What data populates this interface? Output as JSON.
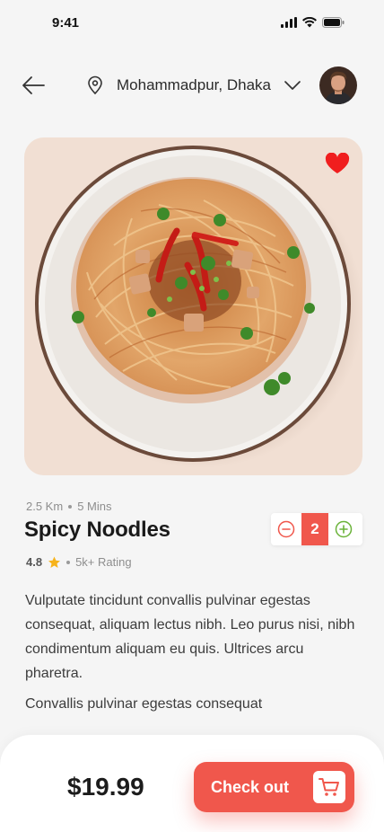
{
  "status": {
    "time": "9:41"
  },
  "header": {
    "location": "Mohammadpur, Dhaka"
  },
  "product": {
    "distance": "2.5 Km",
    "duration": "5 Mins",
    "name": "Spicy Noodles",
    "rating": "4.8",
    "rating_count": "5k+ Rating",
    "quantity": "2",
    "description": "Vulputate tincidunt convallis pulvinar egestas consequat, aliquam lectus nibh. Leo purus nisi, nibh condimentum aliquam eu quis. Ultrices arcu pharetra.",
    "description_2": "Convallis pulvinar egestas consequat",
    "favorite": true
  },
  "footer": {
    "price": "$19.99",
    "checkout_label": "Check out"
  },
  "colors": {
    "accent": "#f0574c",
    "plus": "#6bb33a",
    "star": "#f6b31b",
    "hero_bg": "#f1dfd3"
  },
  "icons": [
    "back-arrow-icon",
    "location-pin-icon",
    "chevron-down-icon",
    "heart-icon",
    "star-icon",
    "minus-icon",
    "plus-icon",
    "cart-icon"
  ]
}
